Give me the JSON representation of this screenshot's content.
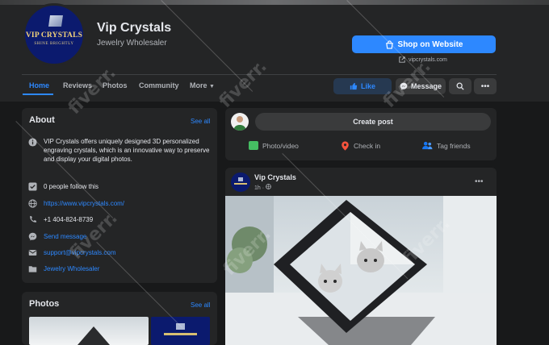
{
  "page": {
    "name": "Vip Crystals",
    "category": "Jewelry Wholesaler",
    "logo_brand": "VIP CRYSTALS",
    "logo_tag": "SHINE BRIGHTLY"
  },
  "actions": {
    "shop_label": "Shop on Website",
    "site": "vipcrystals.com",
    "like_label": "Like",
    "message_label": "Message"
  },
  "tabs": [
    {
      "label": "Home"
    },
    {
      "label": "Reviews"
    },
    {
      "label": "Photos"
    },
    {
      "label": "Community"
    },
    {
      "label": "More"
    }
  ],
  "about": {
    "title": "About",
    "see_all": "See all",
    "description": "VIP Crystals offers uniquely designed 3D personalized engraving crystals, which is an innovative way to preserve and display your digital photos.",
    "followers": "0 people follow this",
    "website": "https://www.vipcrystals.com/",
    "phone": "+1 404-824-8739",
    "message": "Send message",
    "email": "support@vipcrystals.com",
    "category": "Jewelry Wholesaler"
  },
  "photos": {
    "title": "Photos",
    "see_all": "See all"
  },
  "composer": {
    "placeholder": "Create post",
    "photo_video": "Photo/video",
    "check_in": "Check in",
    "tag_friends": "Tag friends"
  },
  "post": {
    "author": "Vip Crystals",
    "time": "1h ·"
  },
  "watermark": "fiverr.",
  "colors": {
    "accent": "#2d88ff",
    "background": "#18191a",
    "card": "#242526"
  }
}
